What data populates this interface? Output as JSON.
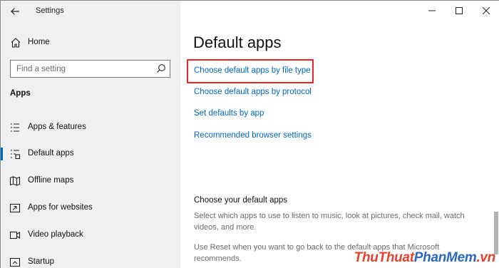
{
  "window": {
    "title": "Settings"
  },
  "sidebar": {
    "home_label": "Home",
    "search_placeholder": "Find a setting",
    "section_title": "Apps",
    "items": [
      {
        "label": "Apps & features",
        "icon": "list-icon"
      },
      {
        "label": "Default apps",
        "icon": "default-apps-icon",
        "selected": true
      },
      {
        "label": "Offline maps",
        "icon": "map-icon"
      },
      {
        "label": "Apps for websites",
        "icon": "website-apps-icon"
      },
      {
        "label": "Video playback",
        "icon": "video-icon"
      },
      {
        "label": "Startup",
        "icon": "startup-icon"
      }
    ]
  },
  "main": {
    "title": "Default apps",
    "links": [
      "Choose default apps by file type",
      "Choose default apps by protocol",
      "Set defaults by app",
      "Recommended browser settings"
    ],
    "subheading": "Choose your default apps",
    "paragraph1": "Select which apps to use to listen to music, look at pictures, check mail, watch videos, and more.",
    "paragraph2": "Use Reset when you want to go back to the default apps that Microsoft recommends."
  },
  "watermark": {
    "part1": "ThuThuat",
    "part2": "PhanMem",
    "part3": ".vn"
  },
  "colors": {
    "accent": "#0067c0",
    "highlight": "#e8262b",
    "sidebar_bg": "#f0f0f0"
  }
}
